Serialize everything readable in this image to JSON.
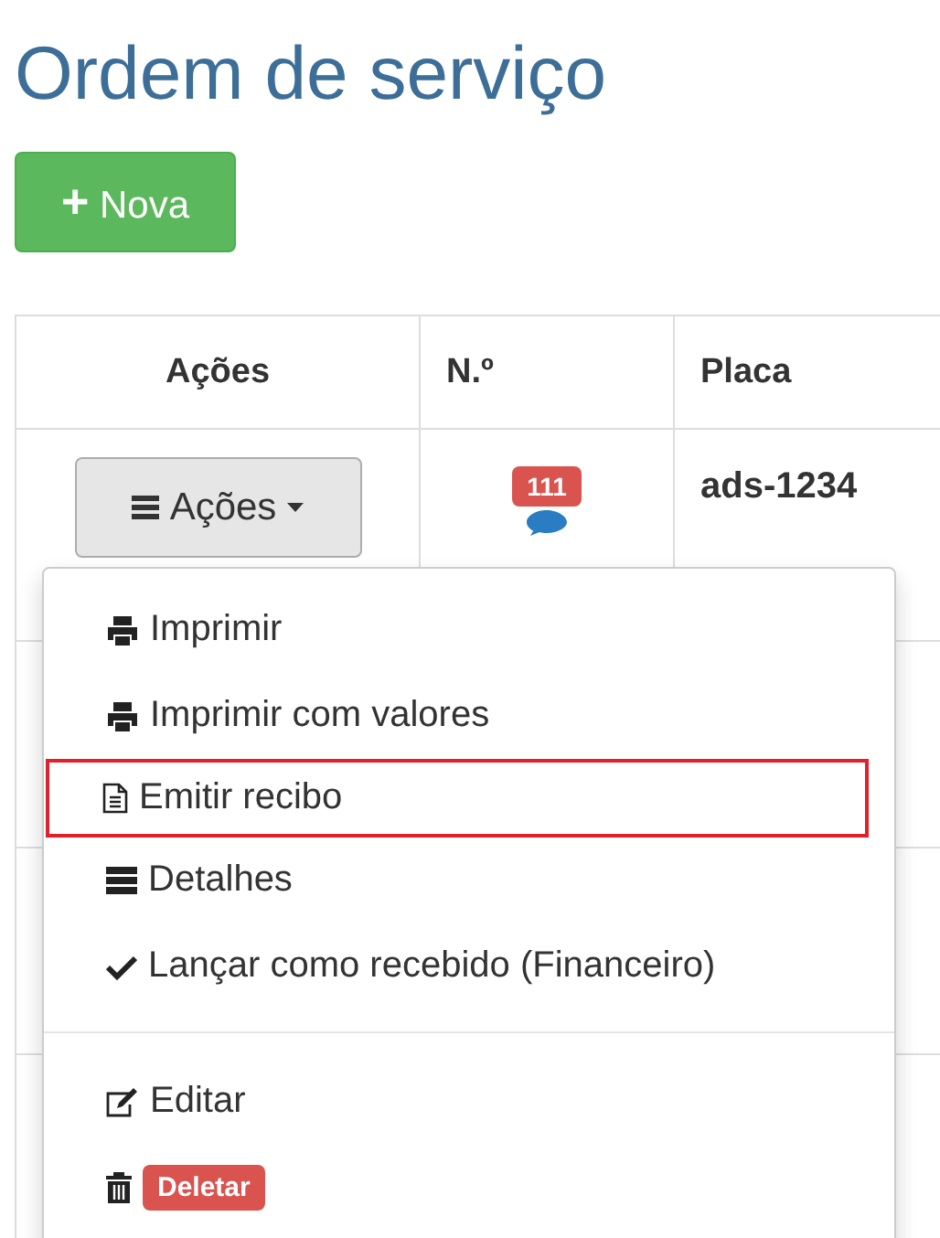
{
  "title": "Ordem de serviço",
  "new_button": {
    "icon": "+",
    "label": "Nova"
  },
  "table": {
    "columns": [
      "Ações",
      "N.º",
      "Placa"
    ],
    "rows": [
      {
        "actions": "Ações",
        "number": "111",
        "plate": "ads-1234"
      }
    ]
  },
  "dropdown": {
    "items": [
      {
        "kind": "item",
        "label": "Imprimir",
        "highlighted": false
      },
      {
        "kind": "item",
        "label": "Imprimir com valores",
        "highlighted": false
      },
      {
        "kind": "item",
        "label": "Emitir recibo",
        "highlighted": true
      },
      {
        "kind": "item",
        "label": "Detalhes",
        "highlighted": false
      },
      {
        "kind": "item",
        "label": "Lançar como recebido (Financeiro)",
        "highlighted": false
      },
      {
        "kind": "divider"
      },
      {
        "kind": "item",
        "label": "Editar",
        "highlighted": false
      },
      {
        "kind": "danger",
        "label": "Deletar"
      }
    ]
  }
}
